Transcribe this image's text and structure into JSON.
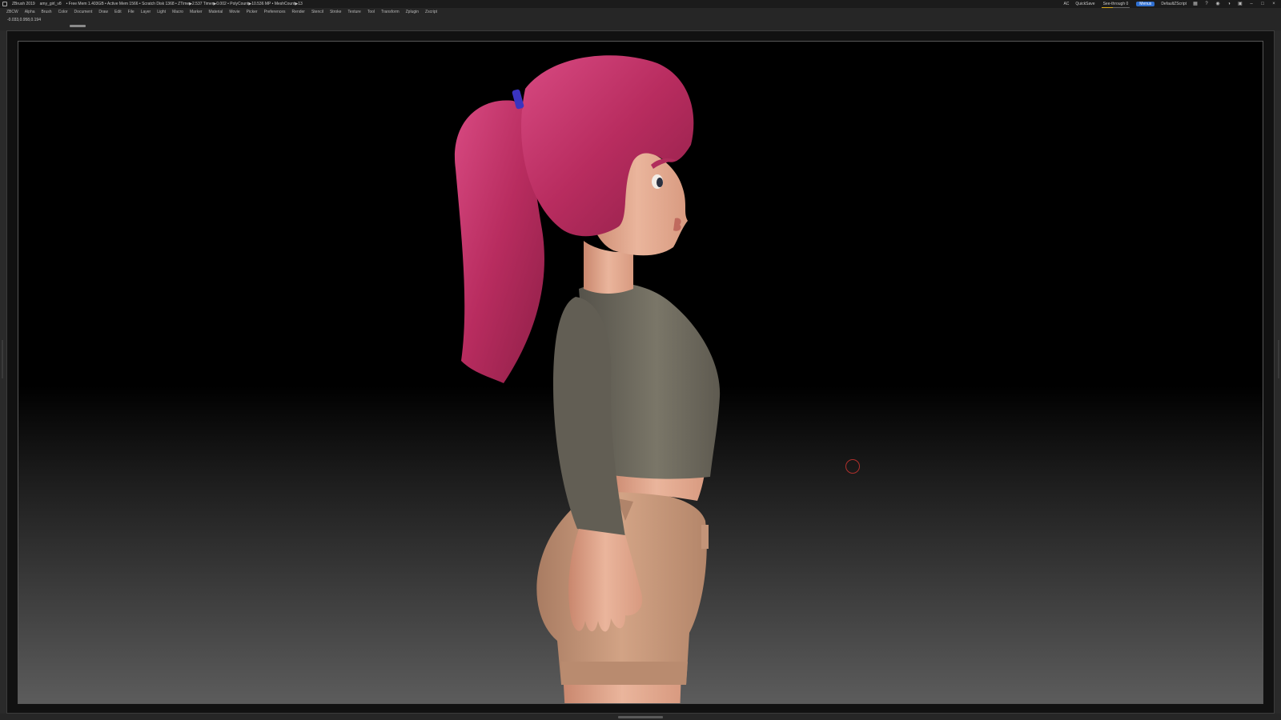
{
  "titlebar": {
    "app": "ZBrush 2019",
    "file": "amy_girl_v8",
    "stats": "• Free Mem 1.403GB • Active Mem 1566 • Scratch Disk 1368 • ZTime▶2.537 Timer▶0.002 • PolyCount▶10.536 MP • MeshCount▶13",
    "ac": "AC",
    "quicksave": "QuickSave",
    "see_through": "See-through 0",
    "menus_btn": "Menus",
    "script": "DefaultZScript"
  },
  "menubar": {
    "items": [
      "ZBCW",
      "Alpha",
      "Brush",
      "Color",
      "Document",
      "Draw",
      "Edit",
      "File",
      "Layer",
      "Light",
      "Macro",
      "Marker",
      "Material",
      "Movie",
      "Picker",
      "Preferences",
      "Render",
      "Stencil",
      "Stroke",
      "Texture",
      "Tool",
      "Transform",
      "Zplugin",
      "Zscript"
    ]
  },
  "infobar": {
    "coords": "-0.033,0.958,0.194"
  },
  "colors": {
    "hair": "#c2356a",
    "skin": "#e4ad94",
    "shirt": "#6e6a5e",
    "shorts": "#c99a7d",
    "tie": "#3a34c0",
    "accent_blue": "#2f6fd0"
  }
}
